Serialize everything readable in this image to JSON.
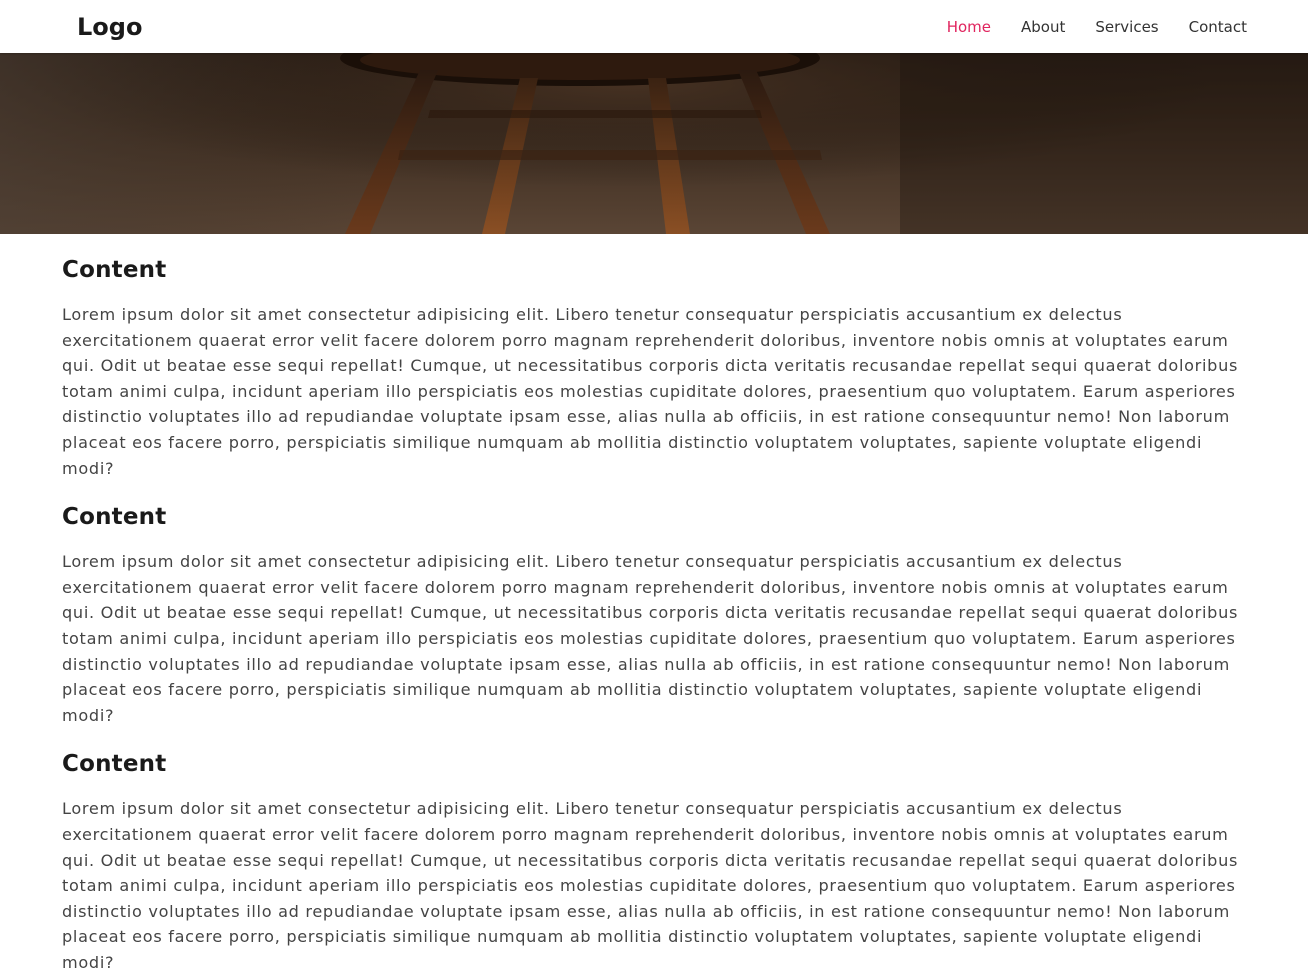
{
  "navbar": {
    "logo": "Logo",
    "links": [
      {
        "label": "Home",
        "active": true
      },
      {
        "label": "About",
        "active": false
      },
      {
        "label": "Services",
        "active": false
      },
      {
        "label": "Contact",
        "active": false
      }
    ],
    "active_color": "#e0245e"
  },
  "sections": [
    {
      "title": "Content",
      "text": "Lorem ipsum dolor sit amet consectetur adipisicing elit. Libero tenetur consequatur perspiciatis accusantium ex delectus exercitationem quaerat error velit facere dolorem porro magnam reprehenderit doloribus, inventore nobis omnis at voluptates earum qui. Odit ut beatae esse sequi repellat! Cumque, ut necessitatibus corporis dicta veritatis recusandae repellat sequi quaerat doloribus totam animi culpa, incidunt aperiam illo perspiciatis eos molestias cupiditate dolores, praesentium quo voluptatem. Earum asperiores distinctio voluptates illo ad repudiandae voluptate ipsam esse, alias nulla ab officiis, in est ratione consequuntur nemo! Non laborum placeat eos facere porro, perspiciatis similique numquam ab mollitia distinctio voluptatem voluptates, sapiente voluptate eligendi modi?"
    },
    {
      "title": "Content",
      "text": "Lorem ipsum dolor sit amet consectetur adipisicing elit. Libero tenetur consequatur perspiciatis accusantium ex delectus exercitationem quaerat error velit facere dolorem porro magnam reprehenderit doloribus, inventore nobis omnis at voluptates earum qui. Odit ut beatae esse sequi repellat! Cumque, ut necessitatibus corporis dicta veritatis recusandae repellat sequi quaerat doloribus totam animi culpa, incidunt aperiam illo perspiciatis eos molestias cupiditate dolores, praesentium quo voluptatem. Earum asperiores distinctio voluptates illo ad repudiandae voluptate ipsam esse, alias nulla ab officiis, in est ratione consequuntur nemo! Non laborum placeat eos facere porro, perspiciatis similique numquam ab mollitia distinctio voluptatem voluptates, sapiente voluptate eligendi modi?"
    },
    {
      "title": "Content",
      "text": "Lorem ipsum dolor sit amet consectetur adipisicing elit. Libero tenetur consequatur perspiciatis accusantium ex delectus exercitationem quaerat error velit facere dolorem porro magnam reprehenderit doloribus, inventore nobis omnis at voluptates earum qui. Odit ut beatae esse sequi repellat! Cumque, ut necessitatibus corporis dicta veritatis recusandae repellat sequi quaerat doloribus totam animi culpa, incidunt aperiam illo perspiciatis eos molestias cupiditate dolores, praesentium quo voluptatem. Earum asperiores distinctio voluptates illo ad repudiandae voluptate ipsam esse, alias nulla ab officiis, in est ratione consequuntur nemo! Non laborum placeat eos facere porro, perspiciatis similique numquam ab mollitia distinctio voluptatem voluptates, sapiente voluptate eligendi modi?"
    }
  ]
}
